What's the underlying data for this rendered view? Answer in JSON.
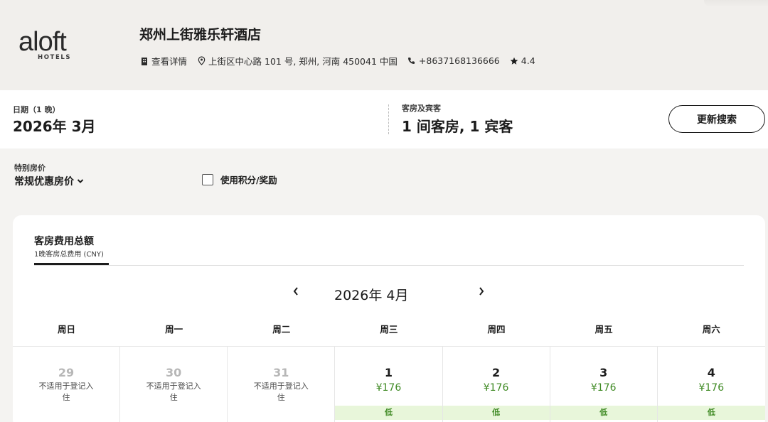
{
  "header": {
    "logo_word": "aloft",
    "logo_sub": "HOTELS",
    "hotel_name": "郑州上街雅乐轩酒店",
    "details_link": "查看详情",
    "address": "上街区中心路 101 号, 郑州, 河南 450041 中国",
    "phone": "+8637168136666",
    "rating": "4.4",
    "icons": [
      "building-icon",
      "map-pin-icon",
      "phone-icon",
      "star-icon"
    ]
  },
  "search": {
    "dates_label": "日期（1 晚）",
    "dates_value": "2026年 3月",
    "rooms_label": "客房及宾客",
    "rooms_value": "1 间客房, 1 宾客",
    "update_button": "更新搜索"
  },
  "filters": {
    "rate_label": "特别房价",
    "rate_value": "常规优惠房价",
    "points_label": "使用积分/奖励",
    "points_checked": false
  },
  "calendar": {
    "tab_title": "客房费用总额",
    "tab_subtitle": "1晚客房总费用 (CNY)",
    "month": "2026年 4月",
    "weekdays": [
      "周日",
      "周一",
      "周二",
      "周三",
      "周四",
      "周五",
      "周六"
    ],
    "days": [
      {
        "day": "29",
        "note": "不适用于登记入住",
        "available": false
      },
      {
        "day": "30",
        "note": "不适用于登记入住",
        "available": false
      },
      {
        "day": "31",
        "note": "不适用于登记入住",
        "available": false
      },
      {
        "day": "1",
        "price": "¥176",
        "tag": "低",
        "available": true
      },
      {
        "day": "2",
        "price": "¥176",
        "tag": "低",
        "available": true
      },
      {
        "day": "3",
        "price": "¥176",
        "tag": "低",
        "available": true
      },
      {
        "day": "4",
        "price": "¥176",
        "tag": "低",
        "available": true
      }
    ]
  },
  "colors": {
    "price_green": "#3f8a24",
    "tag_bg": "#e8f6da",
    "header_bg": "#f1efec"
  }
}
